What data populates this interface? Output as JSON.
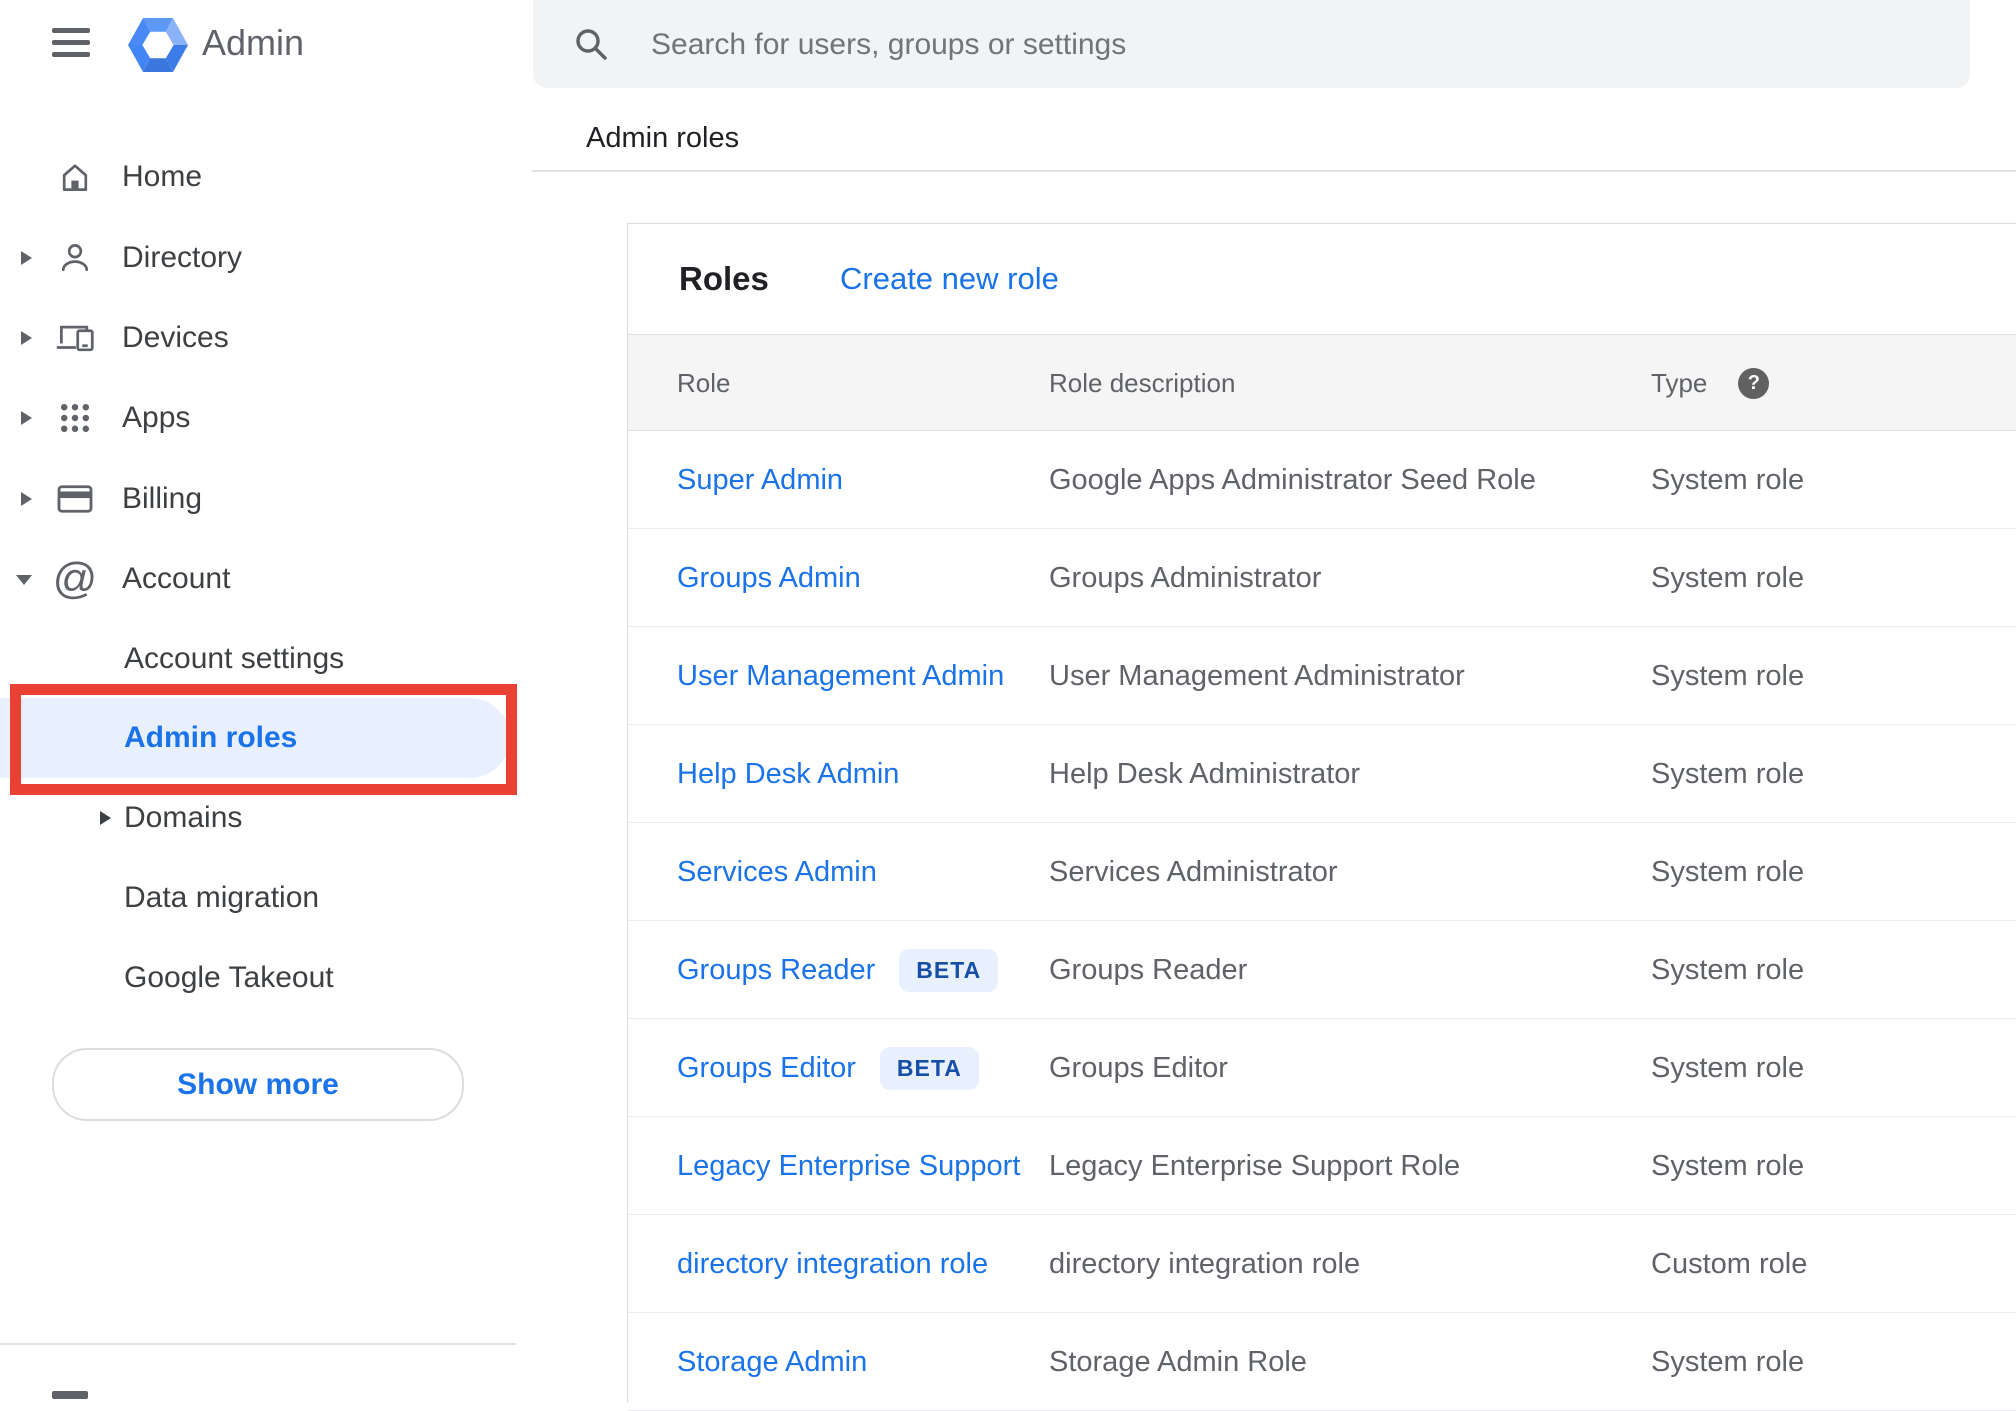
{
  "app": {
    "name": "Admin",
    "menu_icon": "hamburger-menu-icon",
    "logo_icon": "admin-hexagon-logo"
  },
  "search": {
    "placeholder": "Search for users, groups or settings",
    "icon": "search-icon"
  },
  "breadcrumb": "Admin roles",
  "sidebar": {
    "items": [
      {
        "label": "Home",
        "icon": "home-icon",
        "expandable": false
      },
      {
        "label": "Directory",
        "icon": "person-icon",
        "expandable": true
      },
      {
        "label": "Devices",
        "icon": "devices-icon",
        "expandable": true
      },
      {
        "label": "Apps",
        "icon": "apps-grid-icon",
        "expandable": true
      },
      {
        "label": "Billing",
        "icon": "credit-card-icon",
        "expandable": true
      },
      {
        "label": "Account",
        "icon": "at-sign-icon",
        "expanded": true
      }
    ],
    "account_children": [
      {
        "label": "Account settings"
      },
      {
        "label": "Admin roles",
        "selected": true,
        "annotated": "red-box"
      },
      {
        "label": "Domains",
        "expandable": true
      },
      {
        "label": "Data migration"
      },
      {
        "label": "Google Takeout"
      }
    ],
    "show_more_label": "Show more"
  },
  "main": {
    "card_title": "Roles",
    "create_link": "Create new role",
    "table": {
      "headers": {
        "role": "Role",
        "description": "Role description",
        "type": "Type"
      },
      "type_help_icon": "help-circle-icon",
      "help_glyph": "?",
      "rows": [
        {
          "role": "Super Admin",
          "description": "Google Apps Administrator Seed Role",
          "type": "System role"
        },
        {
          "role": "Groups Admin",
          "description": "Groups Administrator",
          "type": "System role"
        },
        {
          "role": "User Management Admin",
          "description": "User Management Administrator",
          "type": "System role"
        },
        {
          "role": "Help Desk Admin",
          "description": "Help Desk Administrator",
          "type": "System role"
        },
        {
          "role": "Services Admin",
          "description": "Services Administrator",
          "type": "System role"
        },
        {
          "role": "Groups Reader",
          "badge": "BETA",
          "description": "Groups Reader",
          "type": "System role"
        },
        {
          "role": "Groups Editor",
          "badge": "BETA",
          "description": "Groups Editor",
          "type": "System role"
        },
        {
          "role": "Legacy Enterprise Support",
          "description": "Legacy Enterprise Support Role",
          "type": "System role"
        },
        {
          "role": "directory integration role",
          "description": "directory integration role",
          "type": "Custom role"
        },
        {
          "role": "Storage Admin",
          "description": "Storage Admin Role",
          "type": "System role"
        }
      ]
    }
  },
  "colors": {
    "accent_blue": "#1a73e8",
    "annotation_red": "#e94235",
    "selected_item_bg": "#e8f0fe",
    "beta_badge_bg": "#e8f0fe",
    "beta_badge_text": "#174ea6",
    "table_header_bg": "#f5f5f5",
    "search_bg": "#f1f3f4",
    "text_dark": "#202124",
    "text_gray": "#5f6368",
    "logo_blue": "#4285f4"
  }
}
